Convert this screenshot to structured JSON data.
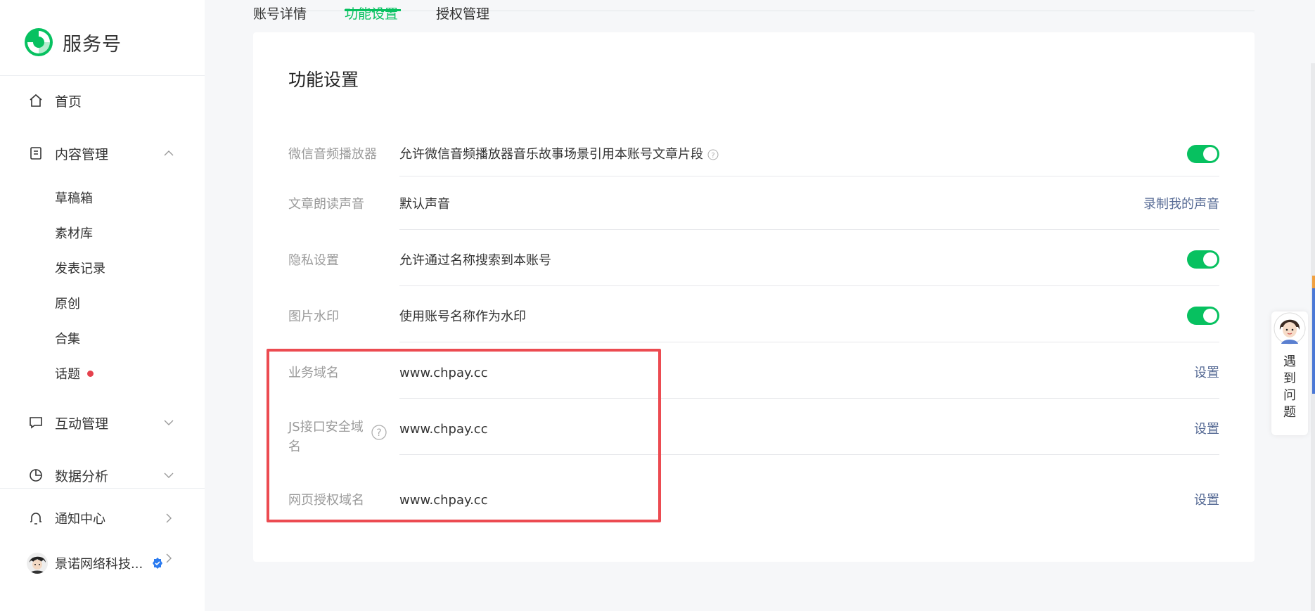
{
  "brand": {
    "name": "服务号",
    "icon": "wechat-service-logo-icon"
  },
  "tabs": [
    {
      "label": "账号详情",
      "active": false
    },
    {
      "label": "功能设置",
      "active": true
    },
    {
      "label": "授权管理",
      "active": false
    }
  ],
  "sidebar": {
    "home": {
      "label": "首页",
      "icon": "home-icon"
    },
    "content": {
      "label": "内容管理",
      "icon": "document-icon",
      "expanded": true,
      "items": [
        {
          "label": "草稿箱"
        },
        {
          "label": "素材库"
        },
        {
          "label": "发表记录"
        },
        {
          "label": "原创"
        },
        {
          "label": "合集"
        },
        {
          "label": "话题",
          "badge_dot": true
        }
      ]
    },
    "interaction": {
      "label": "互动管理",
      "icon": "comment-icon",
      "expanded": false
    },
    "analytics": {
      "label": "数据分析",
      "icon": "pie-chart-icon",
      "expanded": false
    },
    "notifications": {
      "label": "通知中心",
      "icon": "bell-icon"
    },
    "user": {
      "name": "景诺网络科技...",
      "verified": true
    }
  },
  "card": {
    "title": "功能设置",
    "rows": [
      {
        "label": "微信音频播放器",
        "value": "允许微信音频播放器音乐故事场景引用本账号文章片段",
        "control": "toggle",
        "on": true,
        "help": true
      },
      {
        "label": "文章朗读声音",
        "value": "默认声音",
        "action": "录制我的声音"
      },
      {
        "label": "隐私设置",
        "value": "允许通过名称搜索到本账号",
        "control": "toggle",
        "on": true
      },
      {
        "label": "图片水印",
        "value": "使用账号名称作为水印",
        "control": "toggle",
        "on": true
      },
      {
        "label": "业务域名",
        "value": "www.chpay.cc",
        "action": "设置"
      },
      {
        "label_line1": "JS接口安全域",
        "label_line2": "名",
        "value": "www.chpay.cc",
        "action": "设置",
        "help": true
      },
      {
        "label": "网页授权域名",
        "value": "www.chpay.cc",
        "action": "设置"
      }
    ]
  },
  "float_help": {
    "text": "遇\n到\n问\n题"
  },
  "colors": {
    "accent": "#07c160",
    "link": "#576b95",
    "highlight": "#ec4b51",
    "badge": "#e5414d"
  }
}
